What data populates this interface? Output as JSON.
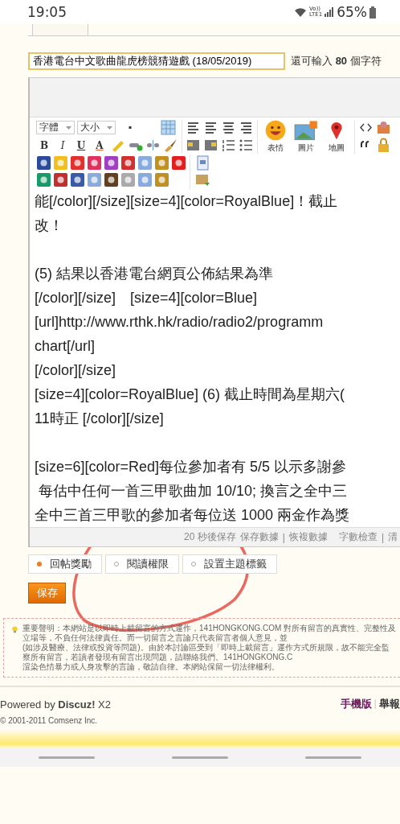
{
  "status_bar": {
    "time": "19:05",
    "volte": "Vo))",
    "network": "LTE1",
    "battery": "65%"
  },
  "title_field": {
    "value": "香港電台中文歌曲龍虎榜競猜遊戲 (18/05/2019)"
  },
  "char_counter": "還可輸入 **80** 個字符",
  "editor": {
    "toolbar": {
      "font_select": "字體",
      "size_select": "大小",
      "format_buttons": [
        "B",
        "I",
        "U",
        "A"
      ],
      "insert_buttons": [
        "表情",
        "圖片",
        "地圖"
      ]
    },
    "paragraphs": [
      [
        "能[/color][/size][size=4][color=RoyalBlue]！截止",
        "改！"
      ],
      [
        "(5) 結果以香港電台網頁公佈結果為準",
        "[/color][/size]　[size=4][color=Blue]",
        "[url]http://www.rthk.hk/radio/radio2/programm",
        "chart[/url]",
        "[/color][/size]",
        "[size=4][color=RoyalBlue] (6) 截止時間為星期六(",
        "11時正 [/color][/size]"
      ],
      [
        "[size=6][color=Red]每位參加者有 5/5 以示多謝參",
        " 每估中任何一首三甲歌曲加 10/10; 換言之全中三",
        "全中三首三甲歌的參加者每位送 1000 兩金作為獎"
      ]
    ],
    "status_items": [
      {
        "kind": "note",
        "text": "20 秒後保存"
      },
      {
        "kind": "link",
        "text": "保存數據"
      },
      {
        "kind": "separator",
        "text": "|"
      },
      {
        "kind": "link",
        "text": "恢複數據"
      },
      {
        "kind": "link",
        "text": "字數檢查"
      },
      {
        "kind": "separator",
        "text": "|"
      },
      {
        "kind": "link",
        "text": "清"
      }
    ]
  },
  "option_tabs": [
    {
      "label": "回帖獎勵",
      "selected": true
    },
    {
      "label": "閱讀權限",
      "selected": false
    },
    {
      "label": "設置主題標籤",
      "selected": false
    }
  ],
  "save_button": "保存",
  "disclaimer": [
    "重要聲明：本網站是以即時上載留言的方式運作，141HONGKONG.COM 對所有留言的真實性、完整性及立場等，不負任何法律責任。而一切留言之言論只代表留言者個人意見，並",
    "(如涉及醫療、法律或投資等問題)。由於本討論區受到「即時上載留言」運作方式所規限，故不能完全監察所有留言，若讀者發現有留言出現問題，請聯絡我們。141HONGKONG.C",
    "渲染色情暴力或人身攻擊的言論，敬請自律。本網站保留一切法律權利。"
  ],
  "footer": {
    "powered": "Powered by **Discuz!** X2",
    "copyright": "© 2001-2011 Comsenz Inc.",
    "links": [
      {
        "kind": "link",
        "text": "手機版"
      },
      {
        "kind": "separator",
        "text": "|"
      },
      {
        "kind": "link",
        "text": "舉報"
      }
    ]
  }
}
